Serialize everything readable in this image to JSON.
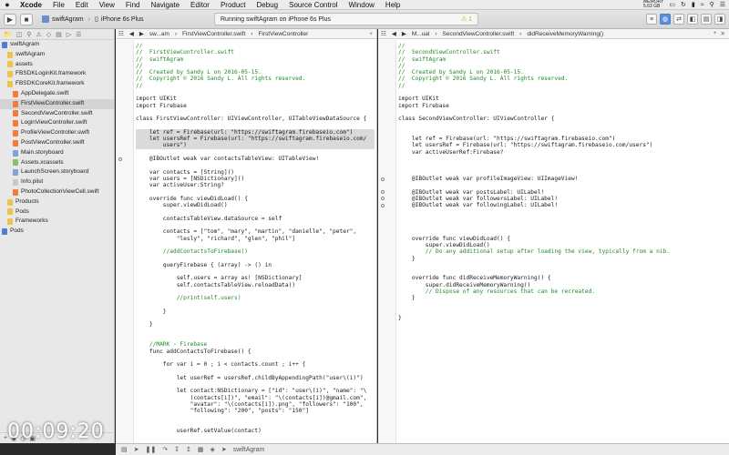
{
  "menubar": {
    "apple": "",
    "items": [
      "Xcode",
      "File",
      "Edit",
      "View",
      "Find",
      "Navigate",
      "Editor",
      "Product",
      "Debug",
      "Source Control",
      "Window",
      "Help"
    ],
    "memory_label": "MEMORY",
    "memory_value": "5.63 GB"
  },
  "toolbar": {
    "scheme": "swiftAgram",
    "device": "iPhone 6s Plus",
    "status_text": "Running swiftAgram on iPhone 6s Plus",
    "warning_count": "1"
  },
  "navigator": {
    "items": [
      {
        "label": "swiftAgram",
        "icon": "project-icon",
        "indent": 0
      },
      {
        "label": "swiftAgram",
        "icon": "folder-icon",
        "indent": 1
      },
      {
        "label": "assets",
        "icon": "folder-icon",
        "indent": 1
      },
      {
        "label": "FBSDKLoginKit.framework",
        "icon": "folder-icon",
        "indent": 1
      },
      {
        "label": "FBSDKCoreKit.framework",
        "icon": "folder-icon",
        "indent": 1
      },
      {
        "label": "AppDelegate.swift",
        "icon": "swift-icon",
        "indent": 2
      },
      {
        "label": "FirstViewController.swift",
        "icon": "swift-icon",
        "indent": 2,
        "selected": true
      },
      {
        "label": "SecondViewController.swift",
        "icon": "swift-icon",
        "indent": 2
      },
      {
        "label": "LoginViewController.swift",
        "icon": "swift-icon",
        "indent": 2
      },
      {
        "label": "ProfileViewController.swift",
        "icon": "swift-icon",
        "indent": 2
      },
      {
        "label": "PostViewController.swift",
        "icon": "swift-icon",
        "indent": 2
      },
      {
        "label": "Main.storyboard",
        "icon": "storyboard-icon",
        "indent": 2
      },
      {
        "label": "Assets.xcassets",
        "icon": "assets-icon",
        "indent": 2
      },
      {
        "label": "LaunchScreen.storyboard",
        "icon": "storyboard-icon",
        "indent": 2
      },
      {
        "label": "Info.plist",
        "icon": "plist-icon",
        "indent": 2
      },
      {
        "label": "PhotoCollectionViewCell.swift",
        "icon": "swift-icon",
        "indent": 2
      },
      {
        "label": "Products",
        "icon": "folder-icon",
        "indent": 1
      },
      {
        "label": "Pods",
        "icon": "folder-icon",
        "indent": 1
      },
      {
        "label": "Frameworks",
        "icon": "folder-icon",
        "indent": 1
      },
      {
        "label": "Pods",
        "icon": "project-icon",
        "indent": 0
      }
    ]
  },
  "left_editor": {
    "jump_path": [
      "sw...am",
      "FirstViewController.swift",
      "FirstViewController"
    ],
    "lines": [
      {
        "t": "//",
        "c": "comment"
      },
      {
        "t": "//  FirstViewController.swift",
        "c": "comment"
      },
      {
        "t": "//  swiftAgram",
        "c": "comment"
      },
      {
        "t": "//",
        "c": "comment"
      },
      {
        "t": "//  Created by Sandy L on 2016-05-15.",
        "c": "comment"
      },
      {
        "t": "//  Copyright © 2016 Sandy L. All rights reserved.",
        "c": "comment"
      },
      {
        "t": "//",
        "c": "comment"
      },
      {
        "t": ""
      },
      {
        "t": "import UIKit"
      },
      {
        "t": "import Firebase"
      },
      {
        "t": ""
      },
      {
        "t": "class FirstViewController: UIViewController, UITableViewDataSource {"
      },
      {
        "t": ""
      },
      {
        "t": "    let ref = Firebase(url: \"https://swiftagram.firebaseio.com\")",
        "c": "hl"
      },
      {
        "t": "    let usersRef = Firebase(url: \"https://swiftagram.firebaseio.com/",
        "c": "hl"
      },
      {
        "t": "        users\")",
        "c": "hl"
      },
      {
        "t": ""
      },
      {
        "t": "    @IBOutlet weak var contactsTableView: UITableView!",
        "outlet": true
      },
      {
        "t": ""
      },
      {
        "t": "    var contacts = [String]()"
      },
      {
        "t": "    var users = [NSDictionary]()"
      },
      {
        "t": "    var activeUser:String?"
      },
      {
        "t": ""
      },
      {
        "t": "    override func viewDidLoad() {"
      },
      {
        "t": "        super.viewDidLoad()"
      },
      {
        "t": ""
      },
      {
        "t": "        contactsTableView.dataSource = self"
      },
      {
        "t": ""
      },
      {
        "t": "        contacts = [\"tom\", \"mary\", \"martin\", \"danielle\", \"peter\","
      },
      {
        "t": "            \"lesly\", \"richard\", \"glen\", \"phil\"]"
      },
      {
        "t": ""
      },
      {
        "t": "        //addContactsToFirebase()",
        "c": "comment"
      },
      {
        "t": ""
      },
      {
        "t": "        queryFirebase { (array) -> () in"
      },
      {
        "t": ""
      },
      {
        "t": "            self.users = array as! [NSDictionary]"
      },
      {
        "t": "            self.contactsTableView.reloadData()"
      },
      {
        "t": ""
      },
      {
        "t": "            //print(self.users)",
        "c": "comment"
      },
      {
        "t": ""
      },
      {
        "t": "        }"
      },
      {
        "t": ""
      },
      {
        "t": "    }"
      },
      {
        "t": ""
      },
      {
        "t": ""
      },
      {
        "t": "    //MARK - Firebase",
        "c": "comment"
      },
      {
        "t": "    func addContactsToFirebase() {"
      },
      {
        "t": ""
      },
      {
        "t": "        for var i = 0 ; i < contacts.count ; i++ {"
      },
      {
        "t": ""
      },
      {
        "t": "            let userRef = usersRef.childByAppendingPath(\"user\\(i)\")"
      },
      {
        "t": ""
      },
      {
        "t": "            let contact:NSDictionary = [\"id\": \"user\\(i)\", \"name\": \"\\"
      },
      {
        "t": "                (contacts[i])\", \"email\": \"\\(contacts[i])@gmail.com\","
      },
      {
        "t": "                \"avatar\": \"\\(contacts[i]).png\", \"followers\": \"100\","
      },
      {
        "t": "                \"following\": \"200\", \"posts\": \"150\"]"
      },
      {
        "t": ""
      },
      {
        "t": ""
      },
      {
        "t": "            userRef.setValue(contact)"
      }
    ]
  },
  "right_editor": {
    "jump_path": [
      "M...ual",
      "SecondViewController.swift",
      "didReceiveMemoryWarning()"
    ],
    "lines": [
      {
        "t": "//",
        "c": "comment"
      },
      {
        "t": "//  SecondViewController.swift",
        "c": "comment"
      },
      {
        "t": "//  swiftAgram",
        "c": "comment"
      },
      {
        "t": "//",
        "c": "comment"
      },
      {
        "t": "//  Created by Sandy L on 2016-05-15.",
        "c": "comment"
      },
      {
        "t": "//  Copyright © 2016 Sandy L. All rights reserved.",
        "c": "comment"
      },
      {
        "t": "//",
        "c": "comment"
      },
      {
        "t": ""
      },
      {
        "t": "import UIKit"
      },
      {
        "t": "import Firebase"
      },
      {
        "t": ""
      },
      {
        "t": "class SecondViewController: UIViewController {"
      },
      {
        "t": ""
      },
      {
        "t": ""
      },
      {
        "t": "    let ref = Firebase(url: \"https://swiftagram.firebaseio.com\")"
      },
      {
        "t": "    let usersRef = Firebase(url: \"https://swiftagram.firebaseio.com/users\")"
      },
      {
        "t": "    var activeUserRef:Firebase?"
      },
      {
        "t": ""
      },
      {
        "t": ""
      },
      {
        "t": ""
      },
      {
        "t": "    @IBOutlet weak var profileImageView: UIImageView!",
        "outlet": true
      },
      {
        "t": ""
      },
      {
        "t": "    @IBOutlet weak var postsLabel: UILabel!",
        "outlet": true
      },
      {
        "t": "    @IBOutlet weak var followersLabel: UILabel!",
        "outlet": true
      },
      {
        "t": "    @IBOutlet weak var followingLabel: UILabel!",
        "outlet": true
      },
      {
        "t": ""
      },
      {
        "t": ""
      },
      {
        "t": ""
      },
      {
        "t": ""
      },
      {
        "t": "    override func viewDidLoad() {"
      },
      {
        "t": "        super.viewDidLoad()"
      },
      {
        "t": "        // Do any additional setup after loading the view, typically from a nib.",
        "c": "comment"
      },
      {
        "t": "    }"
      },
      {
        "t": ""
      },
      {
        "t": ""
      },
      {
        "t": "    override func didReceiveMemoryWarning() {"
      },
      {
        "t": "        super.didReceiveMemoryWarning()"
      },
      {
        "t": "        // Dispose of any resources that can be recreated.",
        "c": "comment"
      },
      {
        "t": "    }"
      },
      {
        "t": ""
      },
      {
        "t": ""
      },
      {
        "t": "}"
      }
    ]
  },
  "debugbar": {
    "target": "swiftAgram"
  },
  "overlay": {
    "timer": "00:09:20"
  }
}
